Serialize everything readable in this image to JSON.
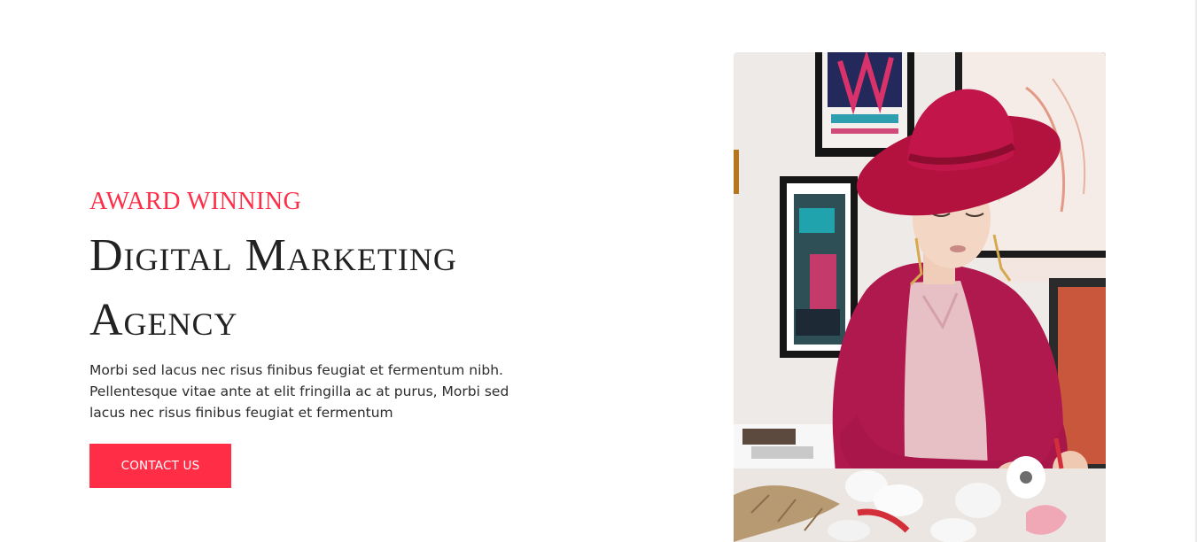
{
  "hero": {
    "eyebrow": "AWARD WINNING",
    "title_line1": "Digital Marketing",
    "title_line2": "Agency",
    "description": "Morbi sed lacus nec risus finibus feugiat et fermentum nibh. Pellentesque vitae ante at elit fringilla ac at purus, Morbi sed lacus nec risus finibus feugiat et fermentum",
    "cta_label": "CONTACT US"
  },
  "colors": {
    "accent": "#ff2d46",
    "heading": "#222222",
    "body_text": "#2c2c2c",
    "background": "#ffffff"
  }
}
